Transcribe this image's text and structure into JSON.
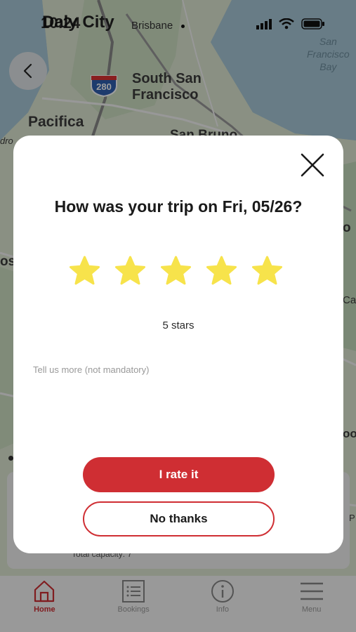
{
  "status_bar": {
    "time": "10:24",
    "icons": [
      "signal-icon",
      "wifi-icon",
      "battery-icon"
    ]
  },
  "map": {
    "labels": {
      "daly_city": "Daly City",
      "brisbane": "Brisbane",
      "south_sf_line1": "South San",
      "south_sf_line2": "Francisco",
      "pacifica": "Pacifica",
      "san_bruno": "San Bruno",
      "bay_line1": "San",
      "bay_line2": "Francisco",
      "bay_line3": "Bay",
      "highway": "280",
      "edge_left_1": "dro",
      "edge_left_2": "os",
      "edge_right_1": "o",
      "edge_right_2": "Ca",
      "edge_right_3": "oo",
      "edge_right_4": "P"
    }
  },
  "underlying_card": {
    "capacity_text": "Total capacity: 7"
  },
  "modal": {
    "title": "How was your trip on Fri, 05/26?",
    "rating": 5,
    "max_rating": 5,
    "stars_label": "5 stars",
    "comment_placeholder": "Tell us more (not mandatory)",
    "comment_value": "",
    "rate_button": "I rate it",
    "no_thanks_button": "No thanks"
  },
  "tabbar": {
    "tabs": [
      {
        "label": "Home",
        "icon": "home-icon",
        "active": true
      },
      {
        "label": "Bookings",
        "icon": "list-icon",
        "active": false
      },
      {
        "label": "Info",
        "icon": "info-icon",
        "active": false
      },
      {
        "label": "Menu",
        "icon": "menu-icon",
        "active": false
      }
    ]
  },
  "colors": {
    "accent": "#cf2e33",
    "star": "#f7e34b",
    "overlay": "rgba(0,0,0,0.38)"
  }
}
